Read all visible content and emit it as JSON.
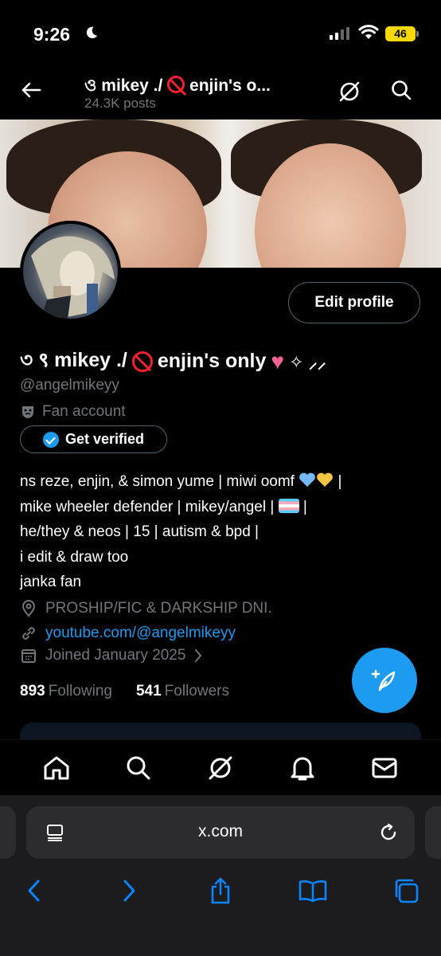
{
  "status_bar": {
    "time": "9:26",
    "battery": "46"
  },
  "header": {
    "title": "ও ९ mikey ./ 🚯 enjin's o...",
    "title_text": "ও mikey ./",
    "title_rest": "enjin's o...",
    "subtitle": "24.3K posts"
  },
  "profile": {
    "name_prefix": "৩ ९ mikey ./",
    "name_suffix": "enjin's only",
    "handle": "@angelmikeyy",
    "category": "Fan account",
    "verify_label": "Get verified",
    "edit_label": "Edit profile",
    "bio": [
      "ns reze, enjin, & simon yume | miwi oomf",
      "|",
      "mike wheeler defender | mikey/angel |",
      "|",
      "he/they & neos | 15 | autism & bpd |",
      "i edit & draw too",
      "janka fan"
    ],
    "location": "PROSHIP/FIC & DARKSHIP DNI.",
    "website": "youtube.com/@angelmikeyy",
    "joined": "Joined January 2025",
    "following_count": "893",
    "following_label": "Following",
    "followers_count": "541",
    "followers_label": "Followers"
  },
  "browser": {
    "url": "x.com"
  },
  "colors": {
    "accent": "#1d9bf0",
    "muted": "#71767b",
    "battery": "#f5d90a"
  },
  "icons": [
    "back-arrow-icon",
    "grok-icon",
    "search-icon",
    "mask-icon",
    "location-icon",
    "link-icon",
    "calendar-icon",
    "compose-icon",
    "home-icon",
    "bell-icon",
    "mail-icon",
    "reader-icon",
    "reload-icon",
    "share-icon",
    "bookmarks-icon",
    "tabs-icon"
  ]
}
